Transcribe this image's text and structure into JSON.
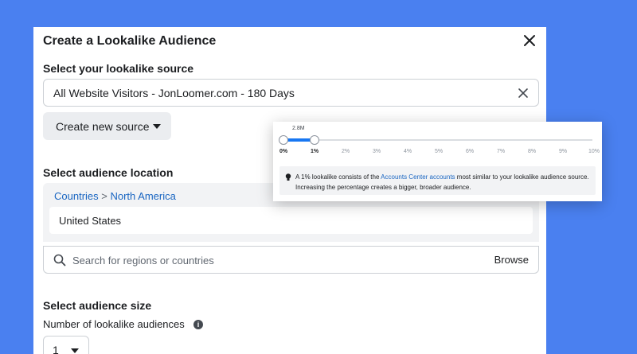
{
  "modal": {
    "title": "Create a Lookalike Audience"
  },
  "source": {
    "label": "Select your lookalike source",
    "value": "All Website Visitors - JonLoomer.com - 180 Days",
    "create_button": "Create new source"
  },
  "location": {
    "label": "Select audience location",
    "breadcrumb": [
      "Countries",
      ">",
      "North America"
    ],
    "selected_country": "United States",
    "search_placeholder": "Search for regions or countries",
    "browse_label": "Browse"
  },
  "size": {
    "label": "Select audience size",
    "number_label": "Number of lookalike audiences",
    "number_value": "1"
  },
  "slider": {
    "reach": "2.8M",
    "ticks": [
      "0%",
      "1%",
      "2%",
      "3%",
      "4%",
      "5%",
      "6%",
      "7%",
      "8%",
      "9%",
      "10%"
    ],
    "selected_range": [
      0,
      1
    ],
    "note_before": "A 1% lookalike consists of the ",
    "note_link": "Accounts Center accounts",
    "note_after": " most similar to your lookalike audience source. Increasing the percentage creates a bigger, broader audience."
  },
  "colors": {
    "background": "#4a80f0",
    "accent": "#1877f2",
    "link": "#1a66c2"
  }
}
